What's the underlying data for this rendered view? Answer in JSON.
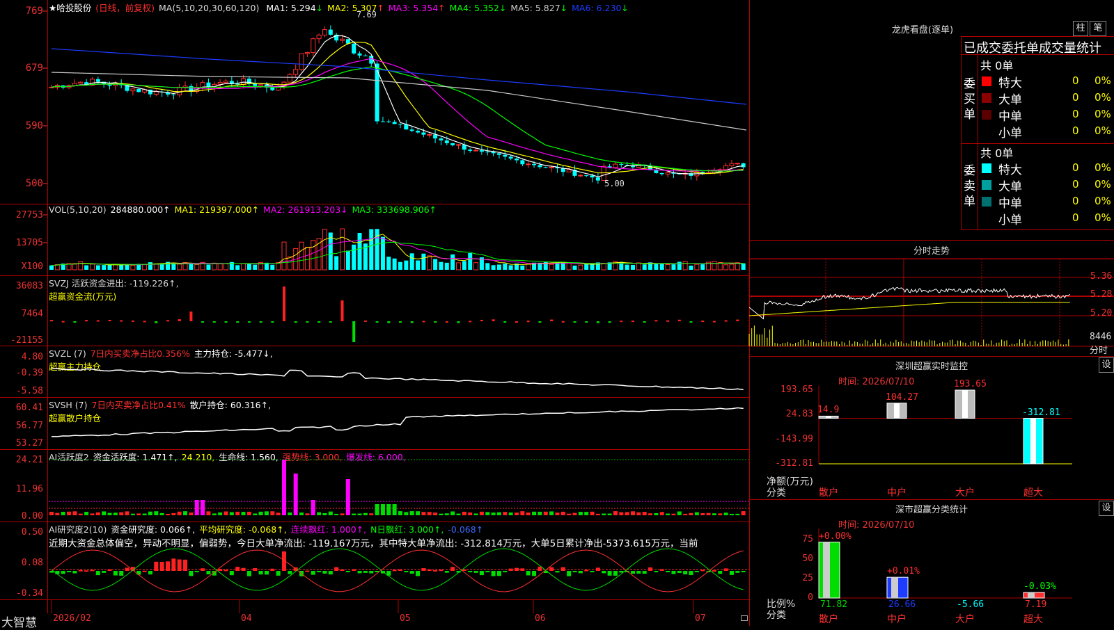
{
  "app": {
    "brand": "大智慧"
  },
  "main_chart": {
    "star": "★",
    "stock_name": "哈投股份",
    "period": "(日线，前复权)",
    "ma_header": "MA(5,10,20,30,60,120)",
    "ma": [
      {
        "label": "MA1: 5.294",
        "arrow": "↓",
        "color": "#ffffff"
      },
      {
        "label": "MA2: 5.307",
        "arrow": "↑",
        "color": "#ffff00"
      },
      {
        "label": "MA3: 5.354",
        "arrow": "↑",
        "color": "#ff00ff"
      },
      {
        "label": "MA4: 5.352",
        "arrow": "↓",
        "color": "#00ff00"
      },
      {
        "label": "MA5: 5.827",
        "arrow": "↓",
        "color": "#cccccc"
      },
      {
        "label": "MA6: 6.230",
        "arrow": "↓",
        "color": "#1e3cff"
      }
    ],
    "yticks": [
      "769",
      "679",
      "590",
      "500"
    ],
    "high_mark": "7.69",
    "low_mark": "5.00"
  },
  "vol_panel": {
    "header": "VOL(5,10,20)",
    "value": "284880.000↑",
    "ma1": "MA1: 219397.000↑",
    "ma2": "MA2: 261913.203↓",
    "ma3": "MA3: 333698.906↑",
    "yticks": [
      "27753",
      "13705",
      "X100"
    ]
  },
  "svzj_panel": {
    "line1": "SVZJ  活跃资金进出: -119.226↑,",
    "line2": "超赢资金流(万元)",
    "yticks": [
      "36083",
      "7464",
      "-21155"
    ]
  },
  "svzl_panel": {
    "name": "SVZL (7)",
    "desc": "7日内买卖净占比0.356%",
    "value": "主力持仓: -5.477↓,",
    "line2": "超赢主力持仓",
    "yticks": [
      "4.80",
      "-0.39",
      "-5.58"
    ]
  },
  "svsh_panel": {
    "name": "SVSH (7)",
    "desc": "7日内买卖净占比0.41%",
    "value": "散户持仓: 60.316↑,",
    "line2": "超赢散户持仓",
    "yticks": [
      "60.41",
      "56.77",
      "53.27"
    ]
  },
  "ai_active_panel": {
    "title": "AI活跃度2",
    "v1": "资金活跃度: 1.471↑,",
    "v2": "24.210,",
    "v3": "生命线: 1.560,",
    "v4": "强势线: 3.000,",
    "v5": "爆发线: 6.000,",
    "yticks": [
      "24.21",
      "11.96",
      "0.00"
    ]
  },
  "ai_research_panel": {
    "title": "AI研究度2(10)",
    "v1": "资金研究度: 0.066↑,",
    "v2": "平均研究度: -0.068↑,",
    "v3": "连续飘红: 1.000↑,",
    "v4": "N日飘红: 3.000↑,",
    "v5": "-0.068↑",
    "summary": "近期大资金总体偏空，异动不明显，偏弱势，今日大单净流出: -119.167万元，其中特大单净流出: -312.814万元，大单5日累计净出-5373.615万元，当前",
    "yticks": [
      "0.50",
      "0.08",
      "-0.34"
    ]
  },
  "xaxis": [
    "2026/02",
    "04",
    "05",
    "06",
    "07"
  ],
  "longhu": {
    "title": "龙虎看盘(逐单)",
    "btn_bar": "柱",
    "btn_pen": "笔",
    "subtitle": "已成交委托单成交量统计",
    "buy_label": "委买单",
    "sell_label": "委卖单",
    "buy_total": "共 0单",
    "sell_total": "共 0单",
    "buy_rows": [
      {
        "name": "特大",
        "count": "0",
        "pct": "0%",
        "color": "#ff0000"
      },
      {
        "name": "大单",
        "count": "0",
        "pct": "0%",
        "color": "#8b0000"
      },
      {
        "name": "中单",
        "count": "0",
        "pct": "0%",
        "color": "#5a0000"
      },
      {
        "name": "小单",
        "count": "0",
        "pct": "0%",
        "color": ""
      }
    ],
    "sell_rows": [
      {
        "name": "特大",
        "count": "0",
        "pct": "0%",
        "color": "#00ffff"
      },
      {
        "name": "大单",
        "count": "0",
        "pct": "0%",
        "color": "#00a0a0"
      },
      {
        "name": "中单",
        "count": "0",
        "pct": "0%",
        "color": "#007070"
      },
      {
        "name": "小单",
        "count": "0",
        "pct": "0%",
        "color": ""
      }
    ]
  },
  "intraday": {
    "title": "分时走势",
    "yticks": [
      "5.36",
      "5.28",
      "5.20"
    ],
    "vol_tick": "8446",
    "vol_label": "分时"
  },
  "monitor": {
    "title": "深圳超赢实时监控",
    "set_btn": "设",
    "time": "时间: 2026/07/10",
    "yticks": [
      "193.65",
      "24.83",
      "-143.99",
      "-312.81"
    ],
    "unit": "净额(万元)",
    "cat_label": "分类",
    "categories": [
      "散户",
      "中户",
      "大户",
      "超大"
    ],
    "values": [
      14.9,
      104.27,
      193.65,
      -312.81
    ],
    "value_labels": [
      "14.9",
      "104.27",
      "193.65",
      "-312.81"
    ]
  },
  "classify": {
    "title": "深市超赢分类统计",
    "set_btn": "设",
    "time": "时间: 2026/07/10",
    "yticks": [
      "75",
      "50",
      "25",
      "0"
    ],
    "unit": "比例%",
    "cat_label": "分类",
    "categories": [
      "散户",
      "中户",
      "大户",
      "超大"
    ],
    "values": [
      71.82,
      26.66,
      -5.66,
      7.19
    ],
    "bottom_labels": [
      "71.82",
      "26.66",
      "-5.66",
      "7.19"
    ],
    "top_labels": [
      "+0.00%",
      "+0.01%",
      "",
      "-0.03%"
    ]
  }
}
